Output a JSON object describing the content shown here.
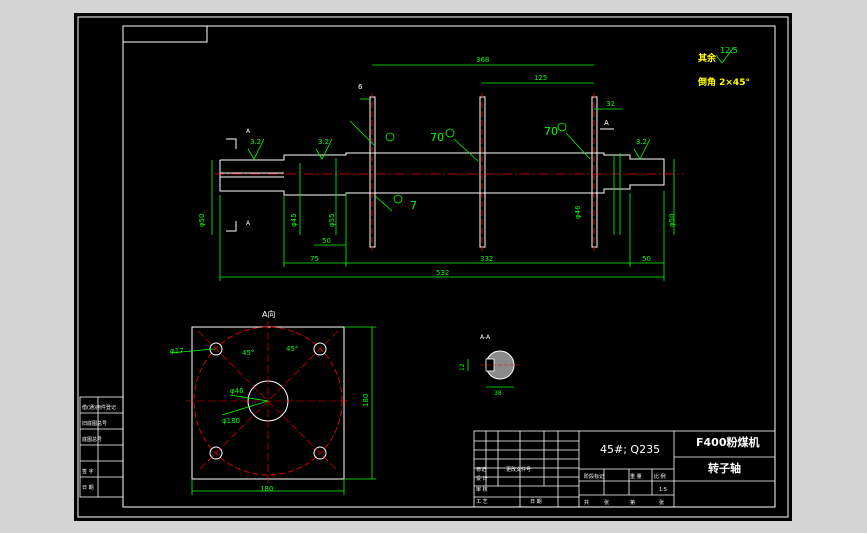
{
  "title_block": {
    "machine": "F400粉煤机",
    "part": "转子轴",
    "material": "45#; Q235",
    "scale": "1:5",
    "cells": [
      "描 图",
      "描 校",
      "底图总号",
      "签 名",
      "日 期",
      "标记",
      "处数",
      "更改文件号",
      "签 名",
      "日 期",
      "设 计",
      "审 核",
      "工 艺",
      "日 期",
      "共",
      "张",
      "第",
      "张",
      "阶段标记",
      "重 量",
      "比 例"
    ],
    "left_strip": [
      "借(通)用件登记",
      "旧底图总号",
      "底图总号",
      "签 字",
      "日 期"
    ]
  },
  "notes": {
    "roughness_label": "其余",
    "roughness_value": "12.5",
    "chamfer": "倒角 2×45°"
  },
  "main_view": {
    "dims": {
      "total_length": "532",
      "len_368": "368",
      "len_125": "125",
      "len_32": "32",
      "len_6": "6",
      "len_75": "75",
      "len_332": "332",
      "len_50a": "50",
      "len_50b": "50",
      "dia_left": "φ50",
      "dia_left2": "φ45",
      "dia_left3": "φ55",
      "dia_mid": "φ46",
      "dia_right": "φ50"
    },
    "roughness": [
      "3.2",
      "3.2",
      "3.2"
    ],
    "weld": [
      "70",
      "70",
      "7"
    ],
    "section_letter": "A"
  },
  "view_a": {
    "title": "A向",
    "hole": "φ17",
    "angle1": "45°",
    "angle2": "45°",
    "inner_dia": "φ46",
    "pcd": "φ180",
    "width": "180",
    "height": "180"
  },
  "section_aa": {
    "label": "A-A",
    "keyway": "12",
    "depth": "38"
  }
}
